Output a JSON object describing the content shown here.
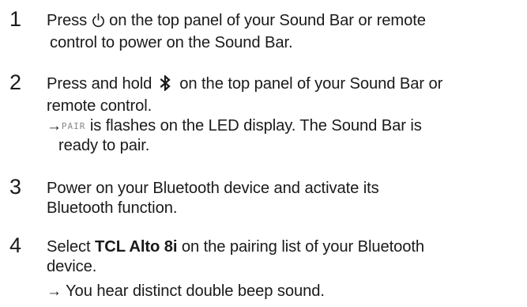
{
  "steps": [
    {
      "number": "1",
      "pre": "Press ",
      "icon": "power-icon",
      "post": " on the top panel of your Sound Bar or remote",
      "line2": "control to power on the Sound Bar."
    },
    {
      "number": "2",
      "pre": "Press and hold ",
      "icon": "bluetooth-icon",
      "post": " on the top panel of your Sound Bar or",
      "line2": "remote control.",
      "result_arrow": "→",
      "result_lcd": "PAIR",
      "result_text": " is flashes on the LED display. The Sound Bar is",
      "result_line2": "ready to pair."
    },
    {
      "number": "3",
      "line1": "Power on your Bluetooth device and activate its",
      "line2": "Bluetooth function."
    },
    {
      "number": "4",
      "pre": "Select ",
      "product": "TCL Alto 8i",
      "post": " on the pairing list of your Bluetooth",
      "line2": "device.",
      "result_arrow": "→",
      "result_text": " You hear distinct double beep sound."
    }
  ]
}
